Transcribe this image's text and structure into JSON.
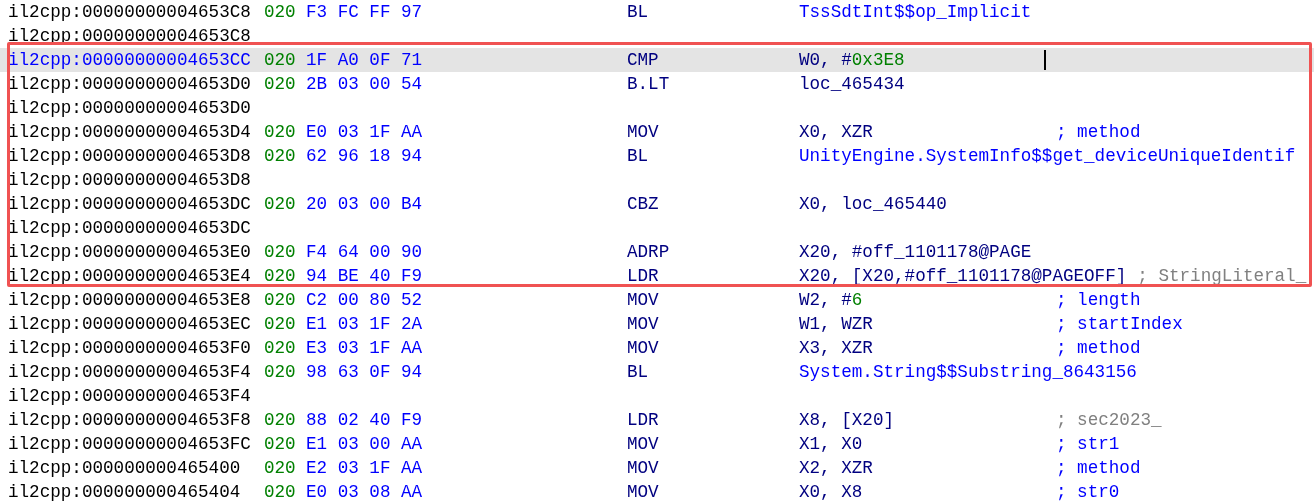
{
  "rows": [
    {
      "address": "il2cpp:00000000004653C8",
      "segment": "020",
      "bytes": "F3 FC FF 97",
      "mnemonic": "BL",
      "operands": [
        {
          "kind": "name",
          "text": "TssSdtInt$$op_Implicit"
        }
      ],
      "selected": false
    },
    {
      "address": "il2cpp:00000000004653C8",
      "selected": false
    },
    {
      "address": "il2cpp:00000000004653CC",
      "segment": "020",
      "bytes": "1F A0 0F 71",
      "mnemonic": "CMP",
      "operands": [
        {
          "kind": "plain",
          "text": "W0, #"
        },
        {
          "kind": "number",
          "text": "0x3E8"
        }
      ],
      "selected": true,
      "cursor": true
    },
    {
      "address": "il2cpp:00000000004653D0",
      "segment": "020",
      "bytes": "2B 03 00 54",
      "mnemonic": "B.LT",
      "operands": [
        {
          "kind": "plain",
          "text": "loc_465434"
        }
      ],
      "selected": false
    },
    {
      "address": "il2cpp:00000000004653D0",
      "selected": false
    },
    {
      "address": "il2cpp:00000000004653D4",
      "segment": "020",
      "bytes": "E0 03 1F AA",
      "mnemonic": "MOV",
      "operands": [
        {
          "kind": "plain",
          "text": "X0, XZR"
        }
      ],
      "comment": {
        "kind": "user",
        "text": "; method"
      },
      "selected": false
    },
    {
      "address": "il2cpp:00000000004653D8",
      "segment": "020",
      "bytes": "62 96 18 94",
      "mnemonic": "BL",
      "operands": [
        {
          "kind": "name",
          "text": "UnityEngine.SystemInfo$$get_deviceUniqueIdentif"
        }
      ],
      "selected": false
    },
    {
      "address": "il2cpp:00000000004653D8",
      "selected": false
    },
    {
      "address": "il2cpp:00000000004653DC",
      "segment": "020",
      "bytes": "20 03 00 B4",
      "mnemonic": "CBZ",
      "operands": [
        {
          "kind": "plain",
          "text": "X0, loc_465440"
        }
      ],
      "selected": false
    },
    {
      "address": "il2cpp:00000000004653DC",
      "selected": false
    },
    {
      "address": "il2cpp:00000000004653E0",
      "segment": "020",
      "bytes": "F4 64 00 90",
      "mnemonic": "ADRP",
      "operands": [
        {
          "kind": "plain",
          "text": "X20, #off_1101178@PAGE"
        }
      ],
      "selected": false
    },
    {
      "address": "il2cpp:00000000004653E4",
      "segment": "020",
      "bytes": "94 BE 40 F9",
      "mnemonic": "LDR",
      "operands": [
        {
          "kind": "plain",
          "text": "X20, [X20,#off_1101178@PAGEOFF]"
        }
      ],
      "comment": {
        "kind": "auto",
        "text": "; StringLiteral_"
      },
      "selected": false
    },
    {
      "address": "il2cpp:00000000004653E8",
      "segment": "020",
      "bytes": "C2 00 80 52",
      "mnemonic": "MOV",
      "operands": [
        {
          "kind": "plain",
          "text": "W2, #"
        },
        {
          "kind": "number",
          "text": "6"
        }
      ],
      "comment": {
        "kind": "user",
        "text": "; length"
      },
      "selected": false
    },
    {
      "address": "il2cpp:00000000004653EC",
      "segment": "020",
      "bytes": "E1 03 1F 2A",
      "mnemonic": "MOV",
      "operands": [
        {
          "kind": "plain",
          "text": "W1, WZR"
        }
      ],
      "comment": {
        "kind": "user",
        "text": "; startIndex"
      },
      "selected": false
    },
    {
      "address": "il2cpp:00000000004653F0",
      "segment": "020",
      "bytes": "E3 03 1F AA",
      "mnemonic": "MOV",
      "operands": [
        {
          "kind": "plain",
          "text": "X3, XZR"
        }
      ],
      "comment": {
        "kind": "user",
        "text": "; method"
      },
      "selected": false
    },
    {
      "address": "il2cpp:00000000004653F4",
      "segment": "020",
      "bytes": "98 63 0F 94",
      "mnemonic": "BL",
      "operands": [
        {
          "kind": "name",
          "text": "System.String$$Substring_8643156"
        }
      ],
      "selected": false
    },
    {
      "address": "il2cpp:00000000004653F4",
      "selected": false
    },
    {
      "address": "il2cpp:00000000004653F8",
      "segment": "020",
      "bytes": "88 02 40 F9",
      "mnemonic": "LDR",
      "operands": [
        {
          "kind": "plain",
          "text": "X8, [X20]"
        }
      ],
      "comment": {
        "kind": "auto",
        "text": "; sec2023_"
      },
      "selected": false
    },
    {
      "address": "il2cpp:00000000004653FC",
      "segment": "020",
      "bytes": "E1 03 00 AA",
      "mnemonic": "MOV",
      "operands": [
        {
          "kind": "plain",
          "text": "X1, X0"
        }
      ],
      "comment": {
        "kind": "user",
        "text": "; str1"
      },
      "selected": false
    },
    {
      "address": "il2cpp:000000000465400",
      "segment": "020",
      "bytes": "E2 03 1F AA",
      "mnemonic": "MOV",
      "operands": [
        {
          "kind": "plain",
          "text": "X2, XZR"
        }
      ],
      "comment": {
        "kind": "user",
        "text": "; method"
      },
      "selected": false
    },
    {
      "address": "il2cpp:000000000465404",
      "segment": "020",
      "bytes": "E0 03 08 AA",
      "mnemonic": "MOV",
      "operands": [
        {
          "kind": "plain",
          "text": "X0, X8"
        }
      ],
      "comment": {
        "kind": "user",
        "text": "; str0"
      },
      "selected": false
    }
  ]
}
